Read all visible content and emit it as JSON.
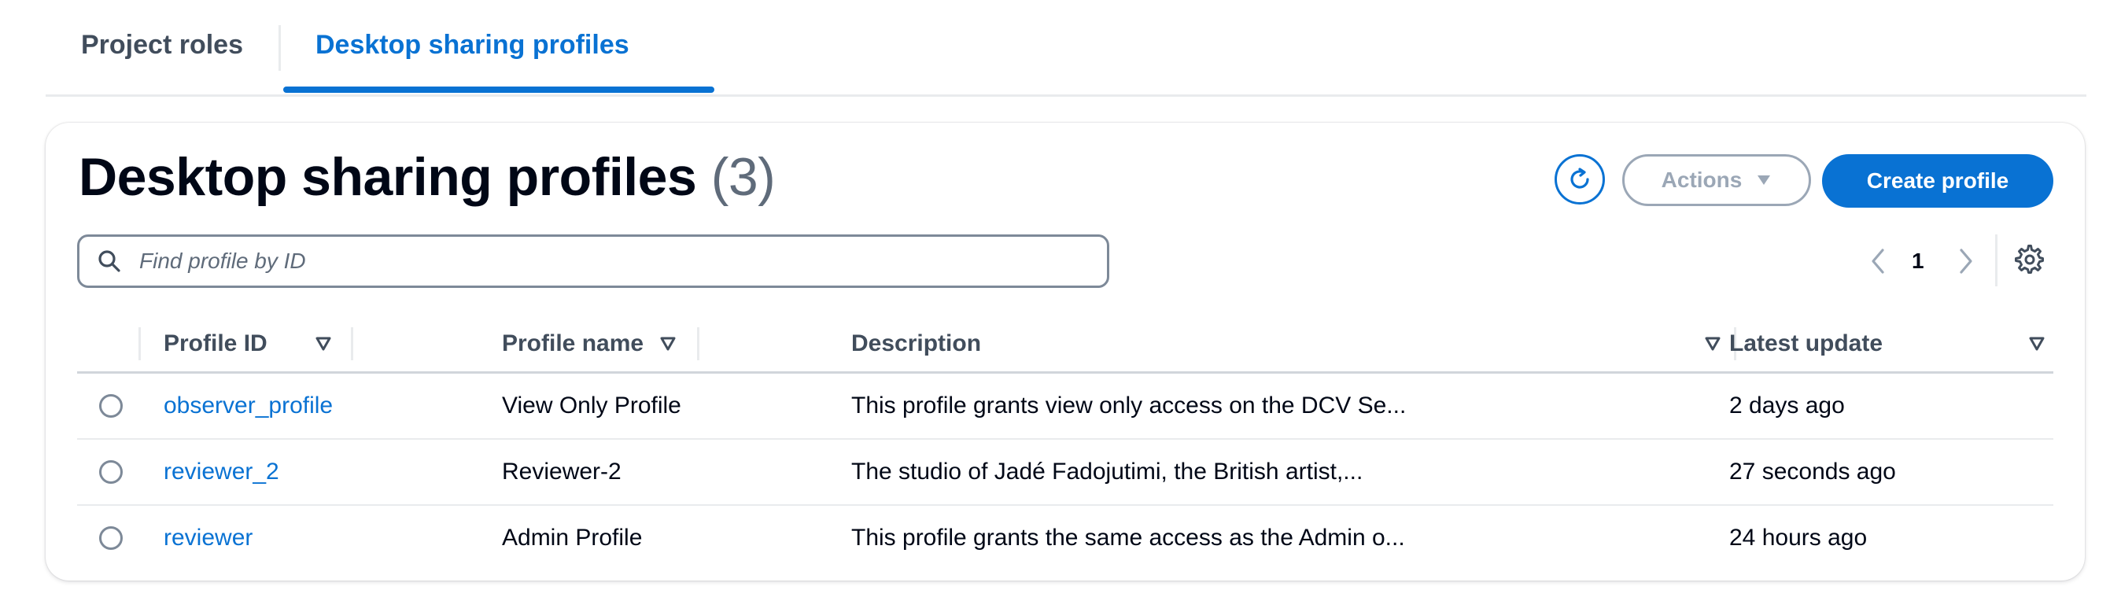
{
  "tabs": [
    {
      "label": "Project roles",
      "active": false
    },
    {
      "label": "Desktop sharing profiles",
      "active": true
    }
  ],
  "panel": {
    "title": "Desktop sharing profiles",
    "count": "(3)",
    "refresh_icon": "refresh-icon",
    "actions_label": "Actions",
    "create_label": "Create profile",
    "search_placeholder": "Find profile by ID",
    "pagination": {
      "current_page": "1"
    }
  },
  "table": {
    "columns": [
      "Profile ID",
      "Profile name",
      "Description",
      "Latest update"
    ],
    "rows": [
      {
        "id": "observer_profile",
        "name": "View Only Profile",
        "description": "This profile grants view only access on the DCV Se...",
        "updated": "2 days ago"
      },
      {
        "id": "reviewer_2",
        "name": "Reviewer-2",
        "description": "The studio of Jadé Fadojutimi, the British artist,...",
        "updated": "27 seconds ago"
      },
      {
        "id": "reviewer",
        "name": "Admin Profile",
        "description": "This profile grants the same access as the Admin o...",
        "updated": "24 hours ago"
      }
    ]
  },
  "colors": {
    "accent": "#0972d3",
    "text": "#000716",
    "muted": "#5f6b7a",
    "disabled": "#9ba7b6"
  }
}
